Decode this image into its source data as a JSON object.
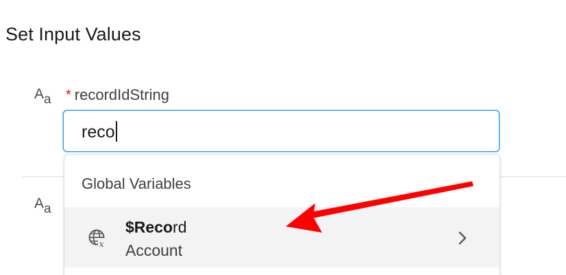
{
  "section": {
    "title": "Set Input Values"
  },
  "field": {
    "required_marker": "*",
    "label": "recordIdString",
    "type_icon_big": "A",
    "type_icon_small": "a",
    "value": "reco"
  },
  "second_field": {
    "type_icon_big": "A",
    "type_icon_small": "a"
  },
  "dropdown": {
    "group_label": "Global Variables",
    "options": [
      {
        "title_match": "$Reco",
        "title_rest": "rd",
        "subtitle": "Account",
        "icon": "global-variable-icon"
      }
    ]
  },
  "annotation": {
    "arrow_color": "#ff0000"
  },
  "colors": {
    "focus_border": "#1b96ff",
    "required": "#ea001e",
    "highlight_row": "#f3f3f3"
  }
}
